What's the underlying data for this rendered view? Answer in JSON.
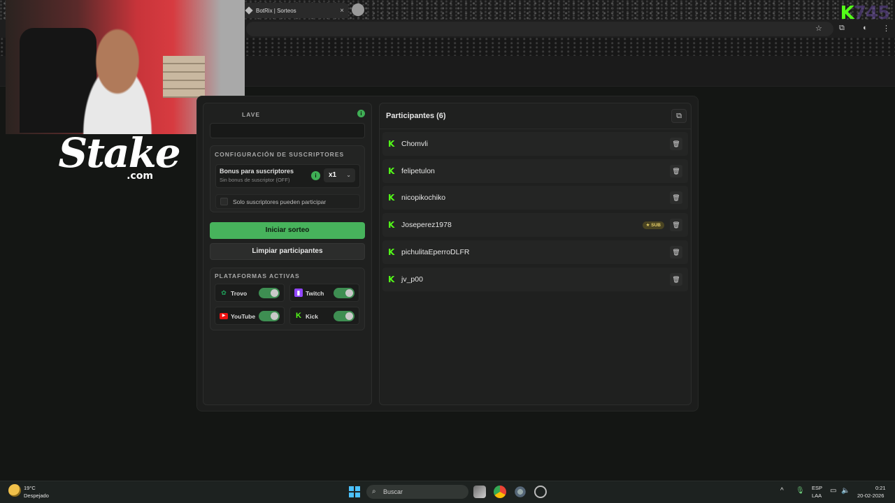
{
  "browser": {
    "tab_title": "BotRix | Sorteos",
    "tab_close": "×",
    "overlay_logo_letter": "K",
    "overlay_logo_digits": "745"
  },
  "overlay": {
    "stake_word": "Stake",
    "stake_domain": ".com"
  },
  "left": {
    "keyword_label_visible": "LAVE",
    "subs_section_title": "CONFIGURACIÓN DE SUSCRIPTORES",
    "bonus_title": "Bonus para suscriptores",
    "bonus_subtitle": "Sin bonus de suscriptor (OFF)",
    "bonus_multiplier": "x1",
    "subs_only_label": "Solo suscriptores pueden participar",
    "start_button": "Iniciar sorteo",
    "clear_button": "Limpiar participantes",
    "platforms_title": "PLATAFORMAS ACTIVAS",
    "platforms": [
      {
        "name": "Trovo",
        "enabled": true,
        "color": "#1fa35b"
      },
      {
        "name": "Twitch",
        "enabled": true,
        "color": "#9146ff"
      },
      {
        "name": "YouTube",
        "enabled": true,
        "color": "#ff0000"
      },
      {
        "name": "Kick",
        "enabled": true,
        "color": "#53fc18"
      }
    ]
  },
  "participants": {
    "title": "Participantes (6)",
    "sub_badge": "SUB",
    "items": [
      {
        "name": "Chomvli",
        "sub": false
      },
      {
        "name": "felipetulon",
        "sub": false
      },
      {
        "name": "nicopikochiko",
        "sub": false
      },
      {
        "name": "Joseperez1978",
        "sub": true
      },
      {
        "name": "pichulitaEperroDLFR",
        "sub": false
      },
      {
        "name": "jv_p00",
        "sub": false
      }
    ]
  },
  "taskbar": {
    "temperature": "19°C",
    "weather": "Despejado",
    "search_placeholder": "Buscar",
    "language": "ESP",
    "layout": "LAA",
    "time": "0:21",
    "date": "20-02-2026"
  },
  "colors": {
    "accent_green": "#47b35c",
    "kick_green": "#53fc18",
    "sub_badge": "#e6cf6a"
  }
}
